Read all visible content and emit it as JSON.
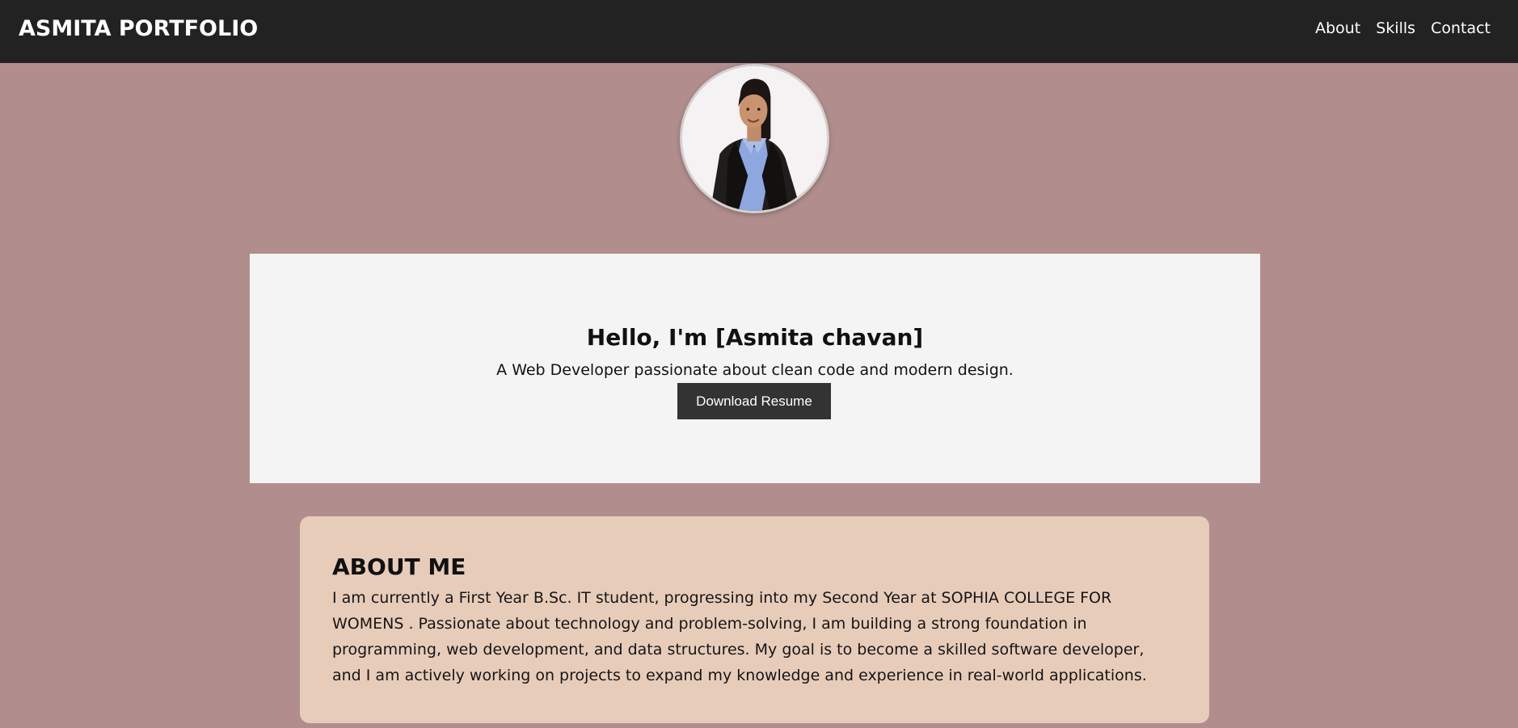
{
  "header": {
    "brand": "ASMITA PORTFOLIO",
    "nav": [
      {
        "label": "About"
      },
      {
        "label": "Skills"
      },
      {
        "label": "Contact"
      }
    ]
  },
  "hero": {
    "title": "Hello, I'm [Asmita chavan]",
    "subtitle": "A Web Developer passionate about clean code and modern design.",
    "button_label": "Download Resume"
  },
  "about": {
    "heading": "ABOUT ME",
    "body": "I am currently a First Year B.Sc. IT student, progressing into my Second Year at SOPHIA COLLEGE FOR WOMENS . Passionate about technology and problem-solving, I am building a strong foundation in programming, web development, and data structures. My goal is to become a skilled software developer, and I am actively working on projects to expand my knowledge and experience in real-world applications."
  },
  "colors": {
    "page_background": "#b18e8d",
    "header_background": "#222222",
    "hero_background": "#f4f4f4",
    "about_background": "#e8ccba",
    "button_background": "#333333"
  },
  "icons": {
    "avatar": "profile-photo"
  }
}
